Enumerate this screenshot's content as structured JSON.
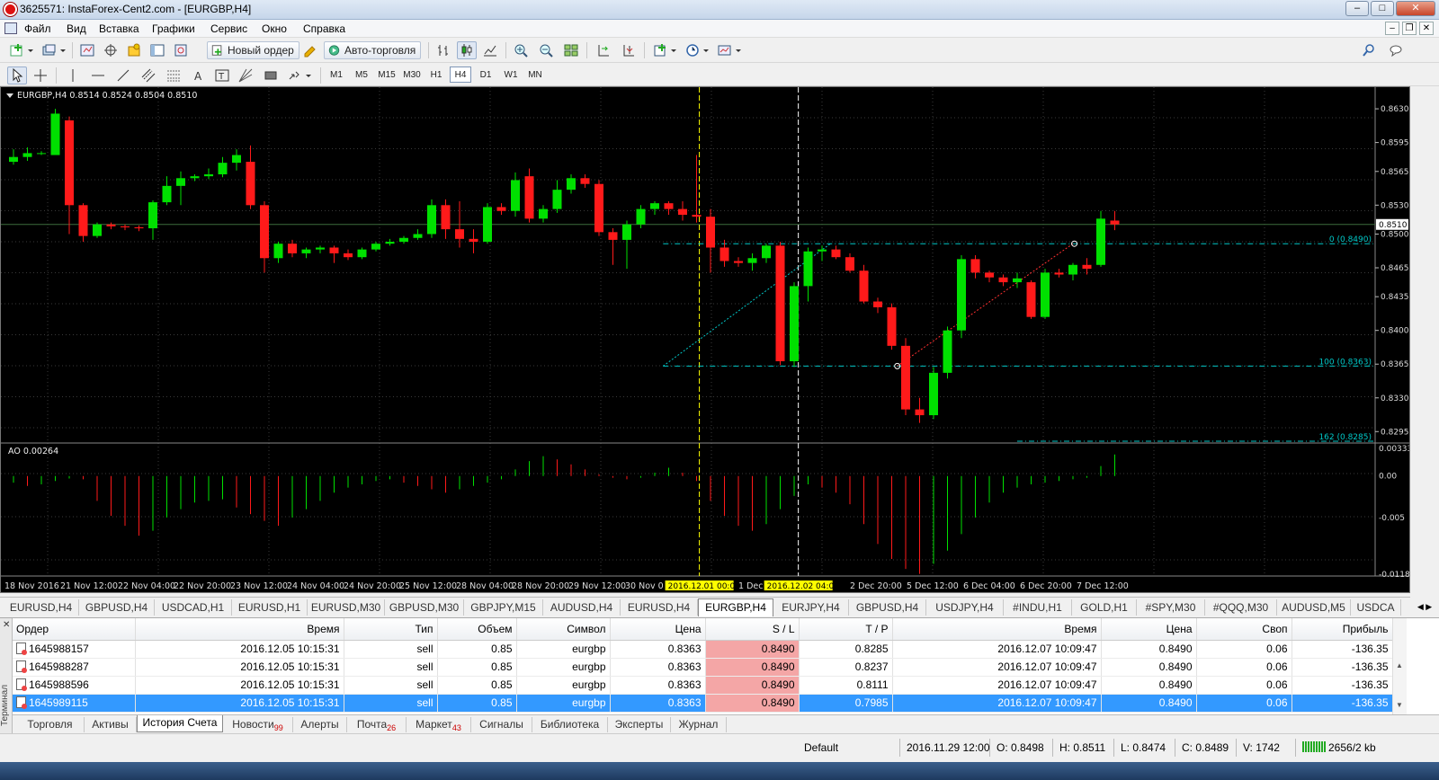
{
  "window": {
    "title": "3625571: InstaForex-Cent2.com - [EURGBP,H4]"
  },
  "menu": [
    "Файл",
    "Вид",
    "Вставка",
    "Графики",
    "Сервис",
    "Окно",
    "Справка"
  ],
  "toolbar": {
    "new_order": "Новый ордер",
    "autotrading": "Авто-торговля"
  },
  "timeframes": [
    "M1",
    "M5",
    "M15",
    "M30",
    "H1",
    "H4",
    "D1",
    "W1",
    "MN"
  ],
  "active_timeframe": "H4",
  "chart": {
    "header": "EURGBP,H4  0.8514 0.8524 0.8504 0.8510",
    "bid_label": "0.8510",
    "price_ticks": [
      "0.8630",
      "0.8595",
      "0.8565",
      "0.8530",
      "0.8500",
      "0.8465",
      "0.8435",
      "0.8400",
      "0.8365",
      "0.8330",
      "0.8295"
    ],
    "ao_label": "AO 0.00264",
    "ao_ticks": [
      "0.00333",
      "0.00",
      "-0.005",
      "-0.01184"
    ],
    "time_ticks": [
      "18 Nov 2016",
      "21 Nov 12:00",
      "22 Nov 04:00",
      "22 Nov 20:00",
      "23 Nov 12:00",
      "24 Nov 04:00",
      "24 Nov 20:00",
      "25 Nov 12:00",
      "28 Nov 04:00",
      "28 Nov 20:00",
      "29 Nov 12:00",
      "30 Nov 0",
      "1 Dec",
      "2 Dec 20:00",
      "5 Dec 12:00",
      "6 Dec 04:00",
      "6 Dec 20:00",
      "7 Dec 12:00"
    ],
    "marker_labels": [
      "2016.12.01 00:00",
      "2016.12.02 04:00"
    ],
    "fib_labels": [
      "0 (0.8490)",
      "100 (0.8363)",
      "162 (0.8285)"
    ],
    "colors": {
      "bull": "#00e000",
      "bear": "#ff1a1a",
      "grid": "#3a3a3a",
      "fib": "#00c8c8",
      "marker": "#ffff00"
    }
  },
  "chart_data": {
    "type": "candlestick",
    "symbol": "EURGBP",
    "timeframe": "H4",
    "ylim": [
      0.8285,
      0.8645
    ],
    "candles": [
      [
        0.8575,
        0.8588,
        0.8572,
        0.858
      ],
      [
        0.858,
        0.859,
        0.8576,
        0.8584
      ],
      [
        0.8584,
        0.8586,
        0.8582,
        0.8584
      ],
      [
        0.8582,
        0.863,
        0.8582,
        0.8625
      ],
      [
        0.8618,
        0.8622,
        0.85,
        0.853
      ],
      [
        0.853,
        0.8532,
        0.8492,
        0.8498
      ],
      [
        0.8498,
        0.8512,
        0.8496,
        0.851
      ],
      [
        0.851,
        0.8512,
        0.8505,
        0.8508
      ],
      [
        0.8508,
        0.851,
        0.8504,
        0.8507
      ],
      [
        0.8507,
        0.8509,
        0.8503,
        0.8506
      ],
      [
        0.8506,
        0.8535,
        0.8494,
        0.8533
      ],
      [
        0.8533,
        0.856,
        0.853,
        0.855
      ],
      [
        0.855,
        0.8565,
        0.853,
        0.8558
      ],
      [
        0.8558,
        0.8562,
        0.8555,
        0.856
      ],
      [
        0.856,
        0.8568,
        0.8557,
        0.8562
      ],
      [
        0.8562,
        0.858,
        0.8559,
        0.8574
      ],
      [
        0.8574,
        0.8588,
        0.8566,
        0.8582
      ],
      [
        0.8575,
        0.8592,
        0.8526,
        0.853
      ],
      [
        0.853,
        0.8534,
        0.846,
        0.8475
      ],
      [
        0.8475,
        0.8492,
        0.847,
        0.849
      ],
      [
        0.849,
        0.8494,
        0.8476,
        0.848
      ],
      [
        0.848,
        0.8486,
        0.8475,
        0.8484
      ],
      [
        0.8484,
        0.8488,
        0.848,
        0.8486
      ],
      [
        0.8486,
        0.8488,
        0.847,
        0.848
      ],
      [
        0.848,
        0.8484,
        0.8473,
        0.8476
      ],
      [
        0.8476,
        0.8486,
        0.8474,
        0.8484
      ],
      [
        0.8484,
        0.8492,
        0.8482,
        0.849
      ],
      [
        0.849,
        0.8495,
        0.8488,
        0.8492
      ],
      [
        0.8492,
        0.8498,
        0.849,
        0.8496
      ],
      [
        0.8496,
        0.8505,
        0.8494,
        0.85
      ],
      [
        0.85,
        0.8536,
        0.8496,
        0.853
      ],
      [
        0.853,
        0.8536,
        0.8495,
        0.8505
      ],
      [
        0.8505,
        0.8534,
        0.8486,
        0.8495
      ],
      [
        0.8495,
        0.8505,
        0.848,
        0.8492
      ],
      [
        0.8492,
        0.8532,
        0.849,
        0.8528
      ],
      [
        0.8528,
        0.8532,
        0.852,
        0.8524
      ],
      [
        0.8524,
        0.8564,
        0.8518,
        0.8556
      ],
      [
        0.856,
        0.8568,
        0.8512,
        0.8516
      ],
      [
        0.8516,
        0.853,
        0.8512,
        0.8526
      ],
      [
        0.8526,
        0.8556,
        0.8522,
        0.8546
      ],
      [
        0.8546,
        0.8562,
        0.8542,
        0.8558
      ],
      [
        0.8558,
        0.8562,
        0.8548,
        0.8552
      ],
      [
        0.8552,
        0.8556,
        0.8498,
        0.8502
      ],
      [
        0.8502,
        0.8506,
        0.8468,
        0.8494
      ],
      [
        0.8494,
        0.8514,
        0.8464,
        0.851
      ],
      [
        0.851,
        0.853,
        0.8506,
        0.8526
      ],
      [
        0.8526,
        0.8534,
        0.852,
        0.8532
      ],
      [
        0.8532,
        0.8534,
        0.852,
        0.8526
      ],
      [
        0.8526,
        0.8534,
        0.8514,
        0.852
      ],
      [
        0.852,
        0.8582,
        0.8512,
        0.8518
      ],
      [
        0.8518,
        0.8526,
        0.846,
        0.8486
      ],
      [
        0.8486,
        0.8494,
        0.8466,
        0.8472
      ],
      [
        0.8472,
        0.8476,
        0.8466,
        0.847
      ],
      [
        0.847,
        0.848,
        0.8462,
        0.8475
      ],
      [
        0.8475,
        0.849,
        0.847,
        0.8488
      ],
      [
        0.8488,
        0.8492,
        0.8364,
        0.8368
      ],
      [
        0.8368,
        0.845,
        0.8362,
        0.8446
      ],
      [
        0.8446,
        0.8486,
        0.843,
        0.8482
      ],
      [
        0.8482,
        0.8488,
        0.8472,
        0.8484
      ],
      [
        0.8484,
        0.8488,
        0.8474,
        0.8476
      ],
      [
        0.8476,
        0.848,
        0.846,
        0.8462
      ],
      [
        0.8462,
        0.8468,
        0.8428,
        0.843
      ],
      [
        0.843,
        0.8434,
        0.8418,
        0.8424
      ],
      [
        0.8424,
        0.8428,
        0.838,
        0.8384
      ],
      [
        0.8384,
        0.8392,
        0.8312,
        0.8318
      ],
      [
        0.8318,
        0.833,
        0.8304,
        0.8312
      ],
      [
        0.8312,
        0.8362,
        0.8308,
        0.8356
      ],
      [
        0.8356,
        0.8404,
        0.835,
        0.84
      ],
      [
        0.84,
        0.8478,
        0.8392,
        0.8474
      ],
      [
        0.8474,
        0.8478,
        0.8454,
        0.846
      ],
      [
        0.846,
        0.8462,
        0.845,
        0.8455
      ],
      [
        0.8455,
        0.8458,
        0.8446,
        0.845
      ],
      [
        0.845,
        0.846,
        0.8444,
        0.8454
      ],
      [
        0.845,
        0.8452,
        0.8412,
        0.8414
      ],
      [
        0.8414,
        0.8464,
        0.8412,
        0.846
      ],
      [
        0.846,
        0.8464,
        0.8455,
        0.8458
      ],
      [
        0.8458,
        0.847,
        0.8452,
        0.8468
      ],
      [
        0.8468,
        0.8475,
        0.8458,
        0.8464
      ],
      [
        0.8468,
        0.8524,
        0.8466,
        0.8516
      ],
      [
        0.8514,
        0.8524,
        0.8504,
        0.851
      ]
    ],
    "ao_values": [
      -0.0008,
      -0.0012,
      -0.001,
      -0.0006,
      -0.0003,
      -0.0004,
      -0.003,
      -0.0048,
      -0.006,
      -0.0072,
      -0.0066,
      -0.005,
      -0.004,
      -0.0032,
      -0.003,
      -0.0028,
      -0.0038,
      -0.0046,
      -0.0054,
      -0.006,
      -0.005,
      -0.004,
      -0.003,
      -0.002,
      -0.0014,
      -0.001,
      -0.0006,
      -0.0004,
      -0.0008,
      -0.0012,
      -0.0016,
      -0.002,
      -0.0016,
      -0.0012,
      -0.0008,
      -0.0004,
      0.0008,
      0.0018,
      0.0024,
      0.002,
      0.0014,
      0.0008,
      0.0002,
      -0.0002,
      -0.0004,
      -0.0002,
      0.0004,
      0.001,
      0.0004,
      -0.0006,
      -0.003,
      -0.0048,
      -0.006,
      -0.0066,
      -0.0058,
      -0.004,
      -0.0024,
      -0.001,
      -0.0014,
      -0.002,
      -0.0034,
      -0.0058,
      -0.0082,
      -0.01,
      -0.0112,
      -0.0118,
      -0.0106,
      -0.009,
      -0.007,
      -0.005,
      -0.0032,
      -0.002,
      -0.0014,
      -0.001,
      -0.0008,
      -0.0006,
      -0.0004,
      -0.0002,
      0.0012,
      0.0026
    ],
    "fib_levels": [
      {
        "label": "0 (0.8490)",
        "price": 0.849
      },
      {
        "label": "100 (0.8363)",
        "price": 0.8363
      },
      {
        "label": "162 (0.8285)",
        "price": 0.8285
      }
    ]
  },
  "chart_tabs": [
    "EURUSD,H4",
    "GBPUSD,H4",
    "USDCAD,H1",
    "EURUSD,H1",
    "EURUSD,M30",
    "GBPUSD,M30",
    "GBPJPY,M15",
    "AUDUSD,H4",
    "EURUSD,H4",
    "EURGBP,H4",
    "EURJPY,H4",
    "GBPUSD,H4",
    "USDJPY,H4",
    "#INDU,H1",
    "GOLD,H1",
    "#SPY,M30",
    "#QQQ,M30",
    "AUDUSD,M5",
    "USDCA"
  ],
  "active_chart_tab": 9,
  "terminal": {
    "side_label": "Терминал",
    "columns": [
      "Ордер",
      "Время",
      "Тип",
      "Объем",
      "Символ",
      "Цена",
      "S / L",
      "T / P",
      "Время",
      "Цена",
      "Своп",
      "Прибыль"
    ],
    "rows": [
      [
        "1645988157",
        "2016.12.05 10:15:31",
        "sell",
        "0.85",
        "eurgbp",
        "0.8363",
        "0.8490",
        "0.8285",
        "2016.12.07 10:09:47",
        "0.8490",
        "0.06",
        "-136.35"
      ],
      [
        "1645988287",
        "2016.12.05 10:15:31",
        "sell",
        "0.85",
        "eurgbp",
        "0.8363",
        "0.8490",
        "0.8237",
        "2016.12.07 10:09:47",
        "0.8490",
        "0.06",
        "-136.35"
      ],
      [
        "1645988596",
        "2016.12.05 10:15:31",
        "sell",
        "0.85",
        "eurgbp",
        "0.8363",
        "0.8490",
        "0.8111",
        "2016.12.07 10:09:47",
        "0.8490",
        "0.06",
        "-136.35"
      ],
      [
        "1645989115",
        "2016.12.05 10:15:31",
        "sell",
        "0.85",
        "eurgbp",
        "0.8363",
        "0.8490",
        "0.7985",
        "2016.12.07 10:09:47",
        "0.8490",
        "0.06",
        "-136.35"
      ]
    ],
    "selected_row": 3,
    "tabs": [
      {
        "label": "Торговля",
        "badge": ""
      },
      {
        "label": "Активы",
        "badge": ""
      },
      {
        "label": "История Счета",
        "badge": ""
      },
      {
        "label": "Новости",
        "badge": "99"
      },
      {
        "label": "Алерты",
        "badge": ""
      },
      {
        "label": "Почта",
        "badge": "26"
      },
      {
        "label": "Маркет",
        "badge": "43"
      },
      {
        "label": "Сигналы",
        "badge": ""
      },
      {
        "label": "Библиотека",
        "badge": ""
      },
      {
        "label": "Эксперты",
        "badge": ""
      },
      {
        "label": "Журнал",
        "badge": ""
      }
    ],
    "active_tab": 2
  },
  "status": {
    "profile": "Default",
    "datetime": "2016.11.29 12:00",
    "open": "O: 0.8498",
    "high": "H: 0.8511",
    "low": "L: 0.8474",
    "close": "C: 0.8489",
    "volume": "V: 1742",
    "traffic": "2656/2 kb"
  }
}
